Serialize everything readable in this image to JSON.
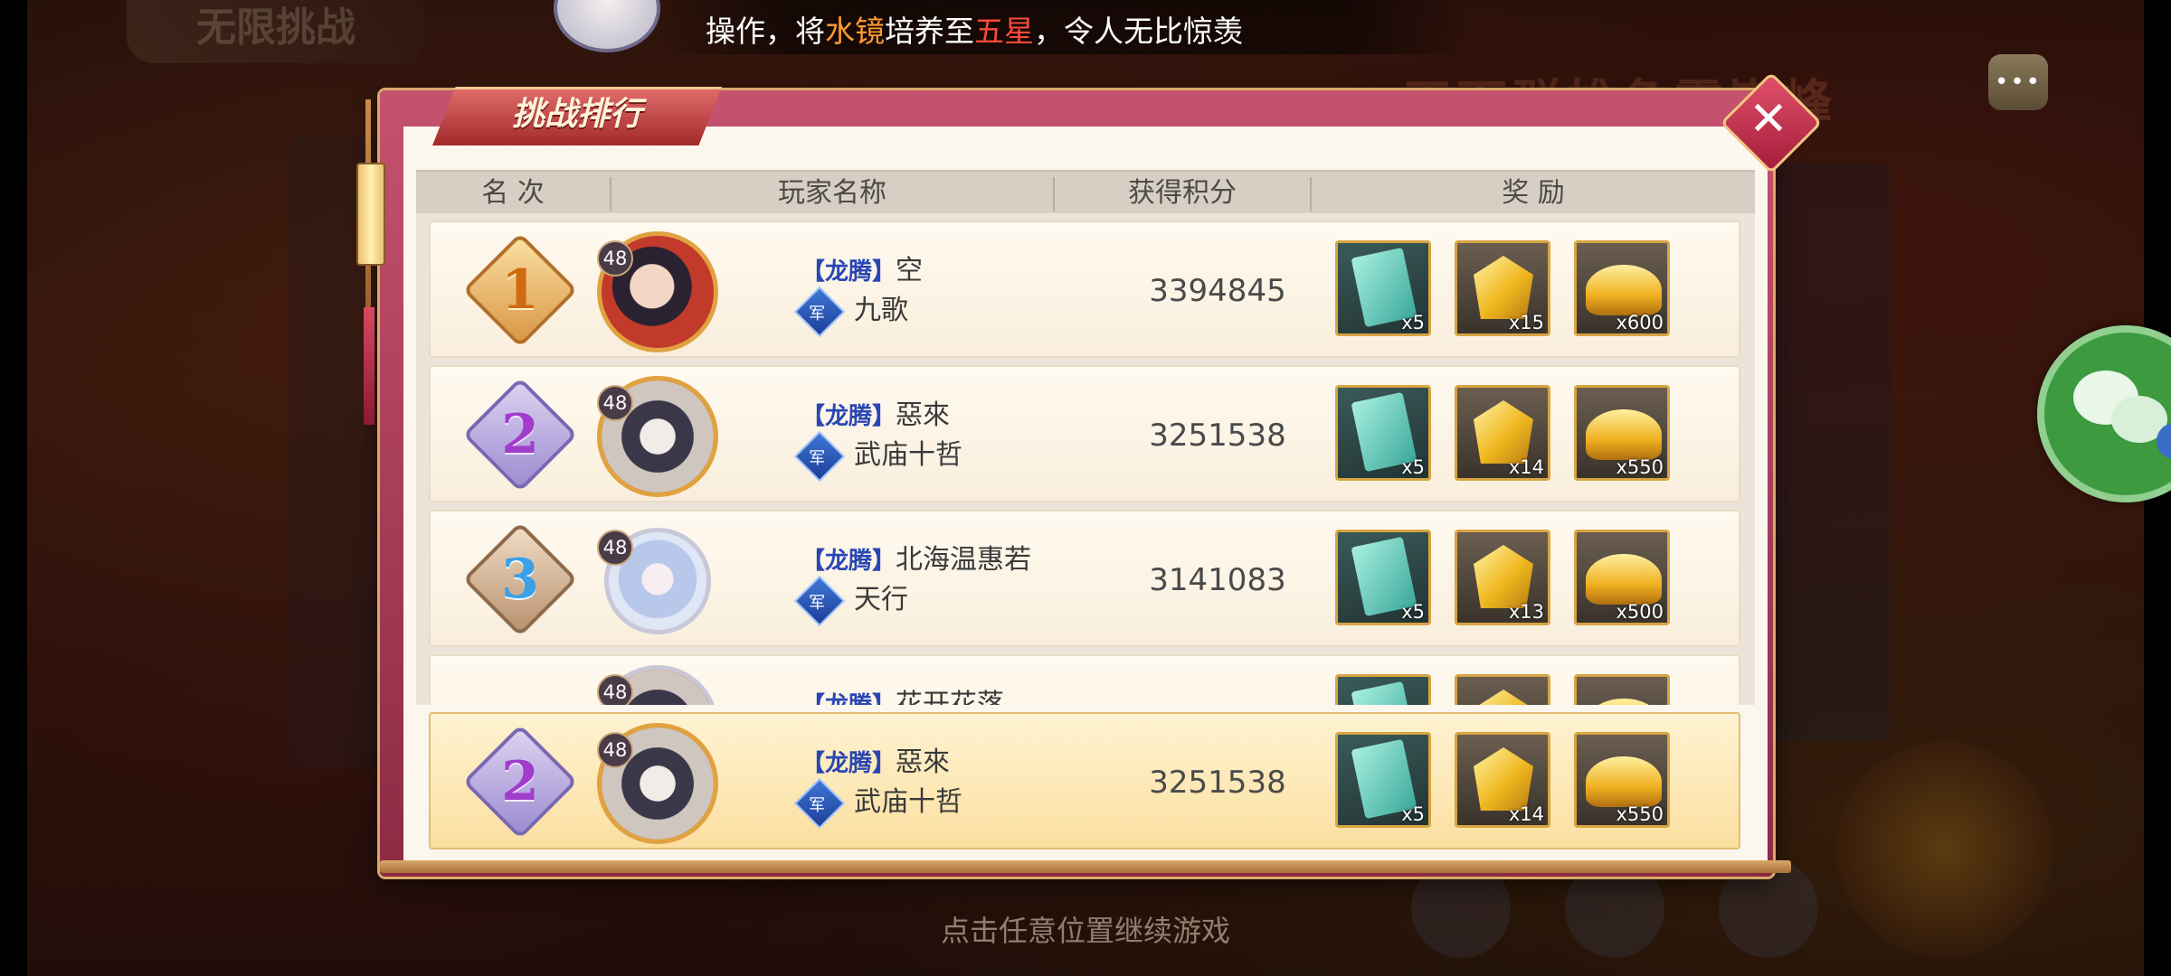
{
  "background": {
    "top_left_badge": "无限挑战",
    "banner": "天下群雄争霸巅峰"
  },
  "notice": {
    "prefix": "操作，将",
    "item": "水镜",
    "middle": "培养至",
    "level": "五星",
    "suffix": "，令人无比惊羡",
    "colors": {
      "item": "#ff9a32",
      "level": "#ff4a3a"
    }
  },
  "modal": {
    "title": "挑战排行",
    "close_icon": "close-icon",
    "columns": {
      "rank": "名 次",
      "player": "玩家名称",
      "score": "获得积分",
      "reward": "奖 励"
    }
  },
  "rows": [
    {
      "rank": "1",
      "level": "48",
      "guild_tag": "【龙腾】",
      "name": "空",
      "army_icon": "军",
      "army": "九歌",
      "score": "3394845",
      "rewards": [
        "x5",
        "x15",
        "x600"
      ]
    },
    {
      "rank": "2",
      "level": "48",
      "guild_tag": "【龙腾】",
      "name": "惡來",
      "army_icon": "军",
      "army": "武庙十哲",
      "score": "3251538",
      "rewards": [
        "x5",
        "x14",
        "x550"
      ]
    },
    {
      "rank": "3",
      "level": "48",
      "guild_tag": "【龙腾】",
      "name": "北海温惠若",
      "army_icon": "军",
      "army": "天行",
      "score": "3141083",
      "rewards": [
        "x5",
        "x13",
        "x500"
      ]
    },
    {
      "level": "48",
      "guild_tag": "【龙腾】",
      "name": "花开花落"
    }
  ],
  "my_rank": {
    "rank": "2",
    "level": "48",
    "guild_tag": "【龙腾】",
    "name": "惡來",
    "army_icon": "军",
    "army": "武庙十哲",
    "score": "3251538",
    "rewards": [
      "x5",
      "x14",
      "x550"
    ]
  },
  "reward_icons": [
    "card-item-icon",
    "gold-nugget-icon",
    "gold-ingot-icon"
  ],
  "footer": {
    "continue": "点击任意位置继续游戏"
  }
}
